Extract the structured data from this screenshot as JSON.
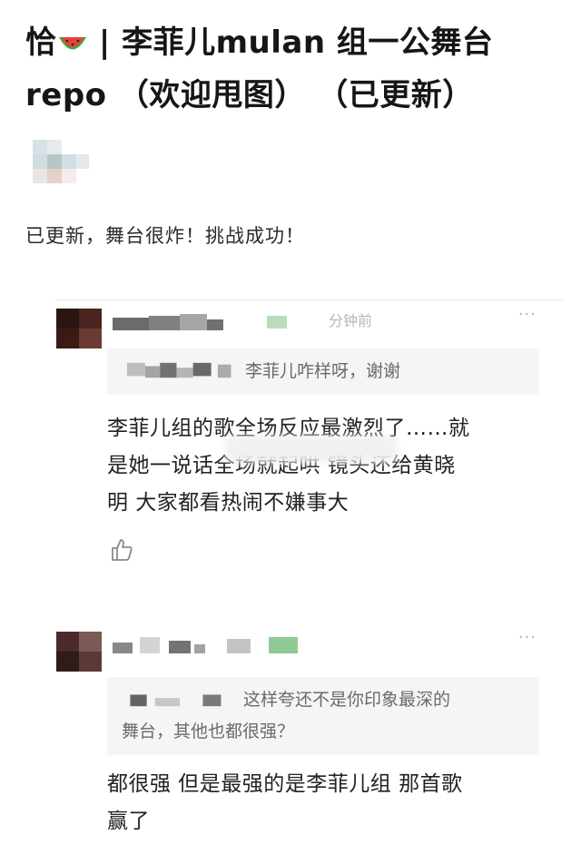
{
  "post": {
    "title_before_emoji": "恰",
    "title_after_emoji": "| 李菲儿mulan 组一公舞台",
    "title_line2": "repo （欢迎甩图） （已更新）",
    "body": "已更新，舞台很炸！挑战成功！"
  },
  "comments": [
    {
      "time": "分钟前",
      "more": "···",
      "quote_text": "李菲儿咋样呀，谢谢",
      "text_lines": [
        "李菲儿组的歌全场反应最激烈了……就",
        "是她一说话全场就起哄 镜头还给黄晓",
        "明 大家都看热闹不嫌事大"
      ]
    },
    {
      "time": "",
      "more": "···",
      "quote_line1": "这样夸还不是你印象最深的",
      "quote_line2": "舞台，其他也都很强？",
      "text_lines": [
        "都很强 但是最强的是李菲儿组 那首歌",
        "赢了"
      ]
    }
  ],
  "colors": {
    "quote_bg": "#f5f5f5",
    "meta_gray": "#b6b6b6",
    "text": "#222222"
  }
}
